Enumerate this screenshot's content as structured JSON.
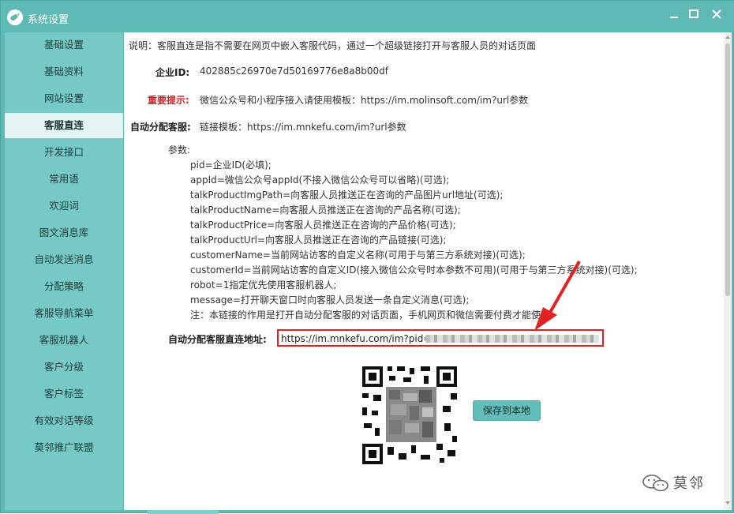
{
  "window": {
    "title": "系统设置",
    "colors": {
      "titlebar": "#5fb9b4",
      "sidebar": "#76c9c4",
      "active_item": "#e3f4f3",
      "highlight_box": "#e02222",
      "important": "#d42020"
    },
    "icons": {
      "logo": "bird-logo-icon",
      "minimize": "minimize-icon",
      "maximize": "maximize-icon",
      "close": "close-icon"
    }
  },
  "sidebar": {
    "items": [
      {
        "label": "基础设置"
      },
      {
        "label": "基础资料"
      },
      {
        "label": "网站设置"
      },
      {
        "label": "客服直连",
        "active": true
      },
      {
        "label": "开发接口"
      },
      {
        "label": "常用语"
      },
      {
        "label": "欢迎词"
      },
      {
        "label": "图文消息库"
      },
      {
        "label": "自动发送消息"
      },
      {
        "label": "分配策略"
      },
      {
        "label": "客服导航菜单"
      },
      {
        "label": "客服机器人"
      },
      {
        "label": "客户分级"
      },
      {
        "label": "客户标签"
      },
      {
        "label": "有效对话等级"
      },
      {
        "label": "莫邻推广联盟"
      }
    ]
  },
  "content": {
    "description": "说明：客服直连是指不需要在网页中嵌入客服代码，通过一个超级链接打开与客服人员的对话页面",
    "company_id_label": "企业ID:",
    "company_id_value": "402885c26970e7d50169776e8a8b00df",
    "important_label": "重要提示:",
    "important_value": "微信公众号和小程序接入请使用模板：https://im.molinsoft.com/im?url参数",
    "auto_assign_label": "自动分配客服:",
    "auto_assign_value": "链接模板：https://im.mnkefu.com/im?url参数",
    "params_label": "参数:",
    "params": [
      "pid=企业ID(必填);",
      "appId=微信公众号appId(不接入微信公众号可以省略)(可选);",
      "talkProductImgPath=向客服人员推送正在咨询的产品图片url地址(可选);",
      "talkProductName=向客服人员推送正在咨询的产品名称(可选);",
      "talkProductPrice=向客服人员推送正在咨询的产品价格(可选);",
      "talkProductUrl=向客服人员推送正在咨询的产品链接(可选);",
      "customerName=当前网站访客的自定义名称(可用于与第三方系统对接)(可选);",
      "customerId=当前网站访客的自定义ID(接入微信公众号时本参数不可用)(可用于与第三方系统对接)(可选);",
      "robot=1指定优先使用客服机器人;",
      "message=打开聊天窗口时向客服人员发送一条自定义消息(可选);",
      "注：本链接的作用是打开自动分配客服的对话页面，手机网页和微信需要付费才能使用"
    ],
    "direct_url_label": "自动分配客服直连地址:",
    "direct_url_prefix": "https://im.mnkefu.com/im?pid=",
    "save_button": "保存到本地"
  },
  "watermark": {
    "text": "莫邻",
    "icon": "wechat-icon"
  }
}
